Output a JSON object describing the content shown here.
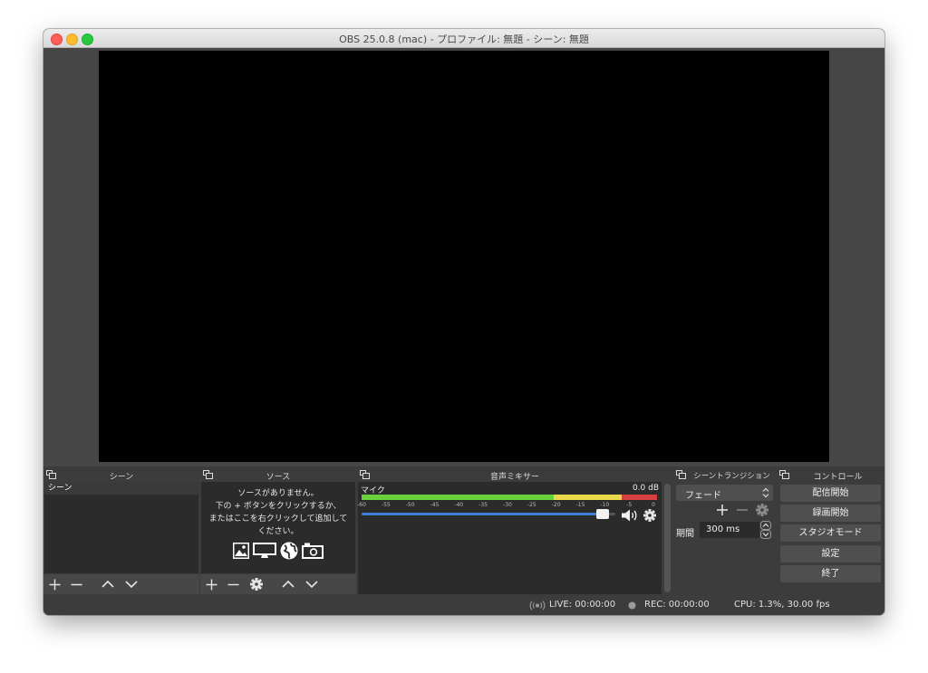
{
  "window": {
    "title": "OBS 25.0.8 (mac) - プロファイル: 無題 - シーン: 無題"
  },
  "scenes": {
    "header": "シーン",
    "items": [
      "シーン"
    ]
  },
  "sources": {
    "header": "ソース",
    "empty_message": [
      "ソースがありません。",
      "下の + ボタンをクリックするか、",
      "またはここを右クリックして追加して",
      "ください。"
    ]
  },
  "mixer": {
    "header": "音声ミキサー",
    "channel": {
      "name": "マイク",
      "level": "0.0 dB",
      "volume_fraction": 0.95
    },
    "scale": [
      "-60",
      "-55",
      "-50",
      "-45",
      "-40",
      "-35",
      "-30",
      "-25",
      "-20",
      "-15",
      "-10",
      "-5",
      "0"
    ]
  },
  "transitions": {
    "header": "シーントランジション",
    "selected": "フェード",
    "duration_label": "期間",
    "duration_value": "300 ms"
  },
  "controls": {
    "header": "コントロール",
    "buttons": [
      "配信開始",
      "録画開始",
      "スタジオモード",
      "設定",
      "終了"
    ]
  },
  "status": {
    "live": "LIVE: 00:00:00",
    "rec": "REC: 00:00:00",
    "cpu": "CPU: 1.3%, 30.00 fps"
  },
  "colors": {
    "meter_green": "#6bd13a",
    "meter_yellow": "#e8d84a",
    "meter_red": "#d64040",
    "volume_blue": "#3f7fd9"
  }
}
